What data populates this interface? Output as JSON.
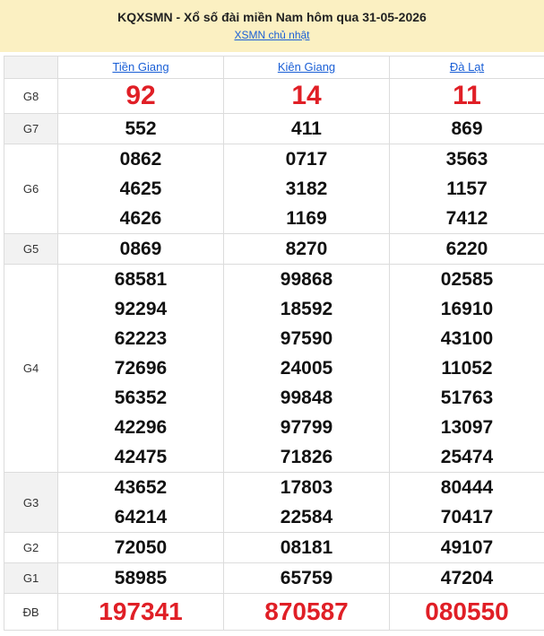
{
  "header": {
    "title": "KQXSMN - Xổ số đài miền Nam hôm qua 31-05-2026",
    "sublink": "XSMN chủ nhật"
  },
  "provinces": [
    "Tiền Giang",
    "Kiên Giang",
    "Đà Lạt"
  ],
  "prizes": {
    "g8": {
      "label": "G8",
      "values": [
        "92",
        "14",
        "11"
      ]
    },
    "g7": {
      "label": "G7",
      "values": [
        "552",
        "411",
        "869"
      ]
    },
    "g6": {
      "label": "G6",
      "values": [
        [
          "0862",
          "4625",
          "4626"
        ],
        [
          "0717",
          "3182",
          "1169"
        ],
        [
          "3563",
          "1157",
          "7412"
        ]
      ]
    },
    "g5": {
      "label": "G5",
      "values": [
        "0869",
        "8270",
        "6220"
      ]
    },
    "g4": {
      "label": "G4",
      "values": [
        [
          "68581",
          "92294",
          "62223",
          "72696",
          "56352",
          "42296",
          "42475"
        ],
        [
          "99868",
          "18592",
          "97590",
          "24005",
          "99848",
          "97799",
          "71826"
        ],
        [
          "02585",
          "16910",
          "43100",
          "11052",
          "51763",
          "13097",
          "25474"
        ]
      ]
    },
    "g3": {
      "label": "G3",
      "values": [
        [
          "43652",
          "64214"
        ],
        [
          "17803",
          "22584"
        ],
        [
          "80444",
          "70417"
        ]
      ]
    },
    "g2": {
      "label": "G2",
      "values": [
        "72050",
        "08181",
        "49107"
      ]
    },
    "g1": {
      "label": "G1",
      "values": [
        "58985",
        "65759",
        "47204"
      ]
    },
    "db": {
      "label": "ĐB",
      "values": [
        "197341",
        "870587",
        "080550"
      ]
    }
  },
  "colors": {
    "header_bg": "#fbf0c2",
    "link": "#1a5fd6",
    "accent_red": "#e01f26"
  }
}
